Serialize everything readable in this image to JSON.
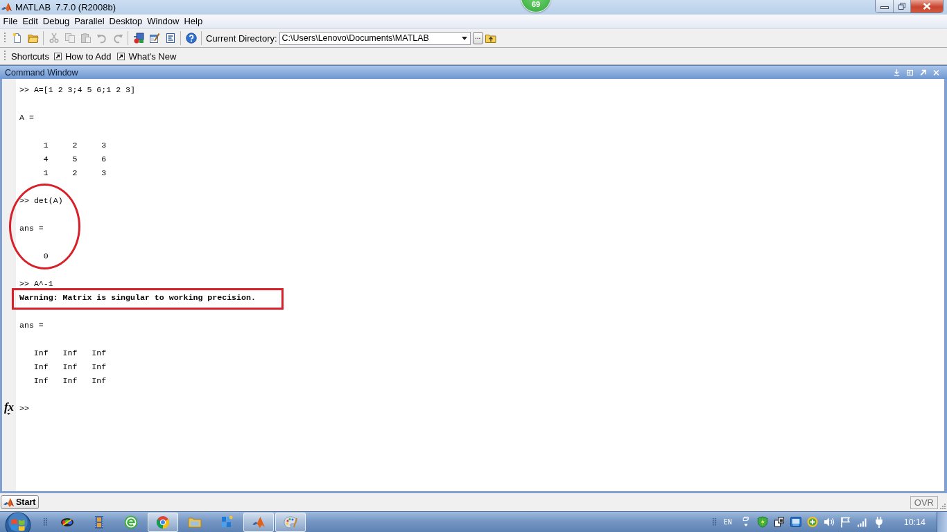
{
  "window": {
    "title": "MATLAB  7.7.0 (R2008b)"
  },
  "floating_badge": {
    "text": "69"
  },
  "menu_bar": [
    "File",
    "Edit",
    "Debug",
    "Parallel",
    "Desktop",
    "Window",
    "Help"
  ],
  "toolbar": {
    "groups": [
      [
        {
          "kind": "new",
          "disabled": false
        },
        {
          "kind": "open",
          "disabled": false
        }
      ],
      [
        {
          "kind": "cut",
          "disabled": true
        },
        {
          "kind": "copy",
          "disabled": true
        },
        {
          "kind": "paste",
          "disabled": true
        },
        {
          "kind": "undo",
          "disabled": true
        },
        {
          "kind": "redo",
          "disabled": true
        }
      ],
      [
        {
          "kind": "model",
          "disabled": false
        },
        {
          "kind": "guide",
          "disabled": false
        },
        {
          "kind": "report",
          "disabled": false
        }
      ],
      [
        {
          "kind": "help",
          "disabled": false
        }
      ]
    ],
    "current_directory": {
      "label": "Current Directory:",
      "value": "C:\\Users\\Lenovo\\Documents\\MATLAB",
      "browse_button": "..."
    }
  },
  "shortcuts_bar": {
    "label": "Shortcuts",
    "items": [
      "How to Add",
      "What's New"
    ]
  },
  "command_window": {
    "title": "Command Window",
    "blocks": [
      {
        "circled": false,
        "boxed": false,
        "lines": [
          {
            "kind": "command",
            "prompt": ">>",
            "text": "A=[1 2 3;4 5 6;1 2 3]"
          },
          {
            "kind": "blank"
          },
          {
            "kind": "output",
            "text": "A ="
          },
          {
            "kind": "blank"
          },
          {
            "kind": "matrix",
            "cells": [
              "1",
              "2",
              "3"
            ]
          },
          {
            "kind": "matrix",
            "cells": [
              "4",
              "5",
              "6"
            ]
          },
          {
            "kind": "matrix",
            "cells": [
              "1",
              "2",
              "3"
            ]
          },
          {
            "kind": "blank"
          }
        ]
      },
      {
        "circled": true,
        "boxed": false,
        "lines": [
          {
            "kind": "command",
            "prompt": ">>",
            "text": "det(A)"
          },
          {
            "kind": "blank"
          },
          {
            "kind": "output",
            "text": "ans ="
          },
          {
            "kind": "blank"
          },
          {
            "kind": "matrix",
            "cells": [
              "0"
            ]
          }
        ]
      },
      {
        "circled": false,
        "boxed": false,
        "lines": [
          {
            "kind": "blank"
          },
          {
            "kind": "command",
            "prompt": ">>",
            "text": "A^-1"
          }
        ]
      },
      {
        "circled": false,
        "boxed": true,
        "lines": [
          {
            "kind": "warning",
            "text": "Warning: Matrix is singular to working precision."
          }
        ]
      },
      {
        "circled": false,
        "boxed": false,
        "lines": [
          {
            "kind": "blank"
          },
          {
            "kind": "output",
            "text": "ans ="
          },
          {
            "kind": "blank"
          },
          {
            "kind": "matrix",
            "cells": [
              "Inf",
              "Inf",
              "Inf"
            ]
          },
          {
            "kind": "matrix",
            "cells": [
              "Inf",
              "Inf",
              "Inf"
            ]
          },
          {
            "kind": "matrix",
            "cells": [
              "Inf",
              "Inf",
              "Inf"
            ]
          },
          {
            "kind": "blank"
          },
          {
            "kind": "prompt",
            "prompt": ">>",
            "button": "fx"
          }
        ]
      }
    ]
  },
  "status_bar": {
    "start_button": "Start",
    "indicator": "OVR"
  },
  "taskbar": {
    "apps": [
      {
        "kind": "swirl",
        "running": false
      },
      {
        "kind": "film",
        "running": false
      },
      {
        "kind": "globe",
        "running": false
      },
      {
        "kind": "wheel",
        "running": true
      },
      {
        "kind": "folder",
        "running": false
      },
      {
        "kind": "tiles",
        "running": false
      },
      {
        "kind": "peak",
        "running": true
      },
      {
        "kind": "palette",
        "running": true
      }
    ]
  },
  "tray": {
    "language": "EN",
    "clock": "10:14"
  }
}
